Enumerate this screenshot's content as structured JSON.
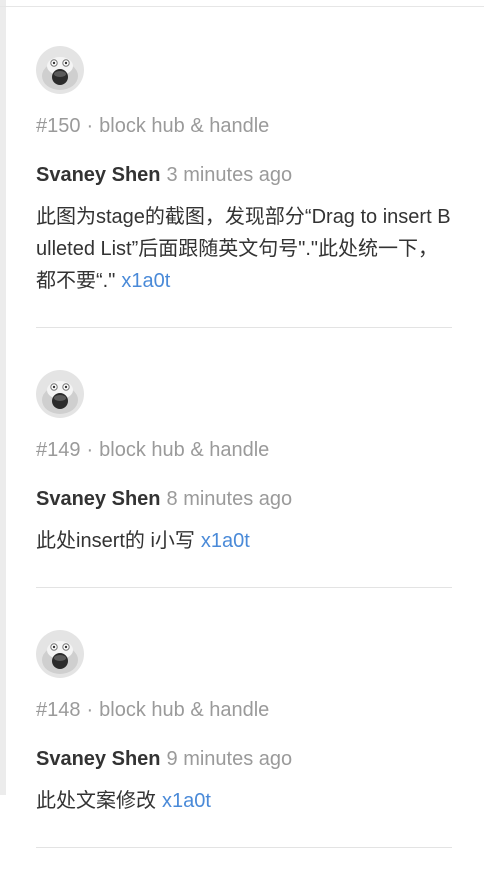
{
  "colors": {
    "text_primary": "#333333",
    "text_muted": "#9a9a9a",
    "link": "#4a8ad8",
    "divider": "#e3e3e3"
  },
  "comments": [
    {
      "avatar_icon": "user-avatar-icon",
      "issue_number": "#150",
      "separator": "·",
      "issue_title": "block hub & handle",
      "author": "Svaney Shen",
      "time": "3 minutes ago",
      "body": "此图为stage的截图，发现部分“Drag to insert Bulleted List”后面跟随英文句号\".\"此处统一下，都不要“.\"",
      "commit": "x1a0t"
    },
    {
      "avatar_icon": "user-avatar-icon",
      "issue_number": "#149",
      "separator": "·",
      "issue_title": "block hub & handle",
      "author": "Svaney Shen",
      "time": "8 minutes ago",
      "body": "此处insert的 i小写",
      "commit": "x1a0t"
    },
    {
      "avatar_icon": "user-avatar-icon",
      "issue_number": "#148",
      "separator": "·",
      "issue_title": "block hub & handle",
      "author": "Svaney Shen",
      "time": "9 minutes ago",
      "body": "此处文案修改",
      "commit": "x1a0t"
    }
  ]
}
